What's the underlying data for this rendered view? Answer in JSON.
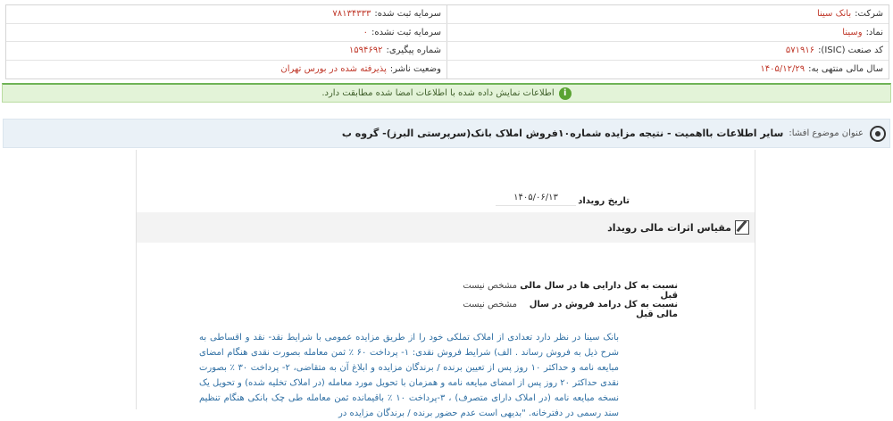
{
  "company_info": {
    "company_label": "شرکت:",
    "company_value": "بانک سینا",
    "registered_capital_label": "سرمایه ثبت شده:",
    "registered_capital_value": "۷۸۱۳۴۳۳۳",
    "symbol_label": "نماد:",
    "symbol_value": "وسینا",
    "unregistered_capital_label": "سرمایه ثبت نشده:",
    "unregistered_capital_value": "۰",
    "isic_label": "کد صنعت (ISIC):",
    "isic_value": "۵۷۱۹۱۶",
    "tracking_label": "شماره پیگیری:",
    "tracking_value": "۱۵۹۴۶۹۲",
    "fiscal_year_label": "سال مالی منتهی به:",
    "fiscal_year_value": "۱۴۰۵/۱۲/۲۹",
    "publisher_status_label": "وضعیت ناشر:",
    "publisher_status_value": "پذیرفته شده در بورس تهران"
  },
  "notice": {
    "text": "اطلاعات نمایش داده شده با اطلاعات امضا شده مطابقت دارد.",
    "icon": "info-icon"
  },
  "subject": {
    "label": "عنوان موضوع افشا:",
    "title": "سایر اطلاعات بااهمیت - نتیجه مزایده شماره۱۰فروش املاک بانک(سرپرستی البرز)- گروه ب"
  },
  "event": {
    "date_label": "تاریخ رویداد",
    "date_value": "۱۴۰۵/۰۶/۱۳"
  },
  "section": {
    "title": "مقیاس اثرات مالی رویداد",
    "icon": "edit-icon"
  },
  "ratios": [
    {
      "label": "نسبت به کل دارایی ها در سال مالی قبل",
      "value": "مشخص نیست"
    },
    {
      "label": "نسبت به کل درامد فروش در سال مالی قبل",
      "value": "مشخص نیست"
    }
  ],
  "description": "بانک سینا در نظر دارد تعدادی از املاک تملکی خود را از طریق مزایده عمومی با شرایط نقد- نقد و اقساطی به شرح ذیل به فروش رساند . الف) شرایط فروش نقدی: ۱- پرداخت ۶۰ ٪ ثمن معامله بصورت نقدی هنگام امضای مبایعه نامه و حداکثر ۱۰ روز پس از تعیین برنده / برندگان مزایده و ابلاغ آن به متقاضی، ۲- پرداخت ۳۰ ٪ بصورت نقدی حداکثر ۲۰ روز پس از امضای مبایعه نامه و همزمان با تحویل مورد معامله (در املاک تخلیه شده) و تحویل یک نسخه مبایعه نامه (در املاک دارای متصرف) ، ۳-پرداخت ۱۰ ٪ باقیمانده ثمن معامله طی چک بانکی هنگام تنظیم سند رسمی در دفترخانه. \"بدیهی است عدم حضور برنده / برندگان مزایده در",
  "colors": {
    "value_red": "#c0392b",
    "notice_green": "#e3f3d8",
    "subject_bg": "#eaf1f7",
    "desc_blue": "#2f6fa3"
  }
}
